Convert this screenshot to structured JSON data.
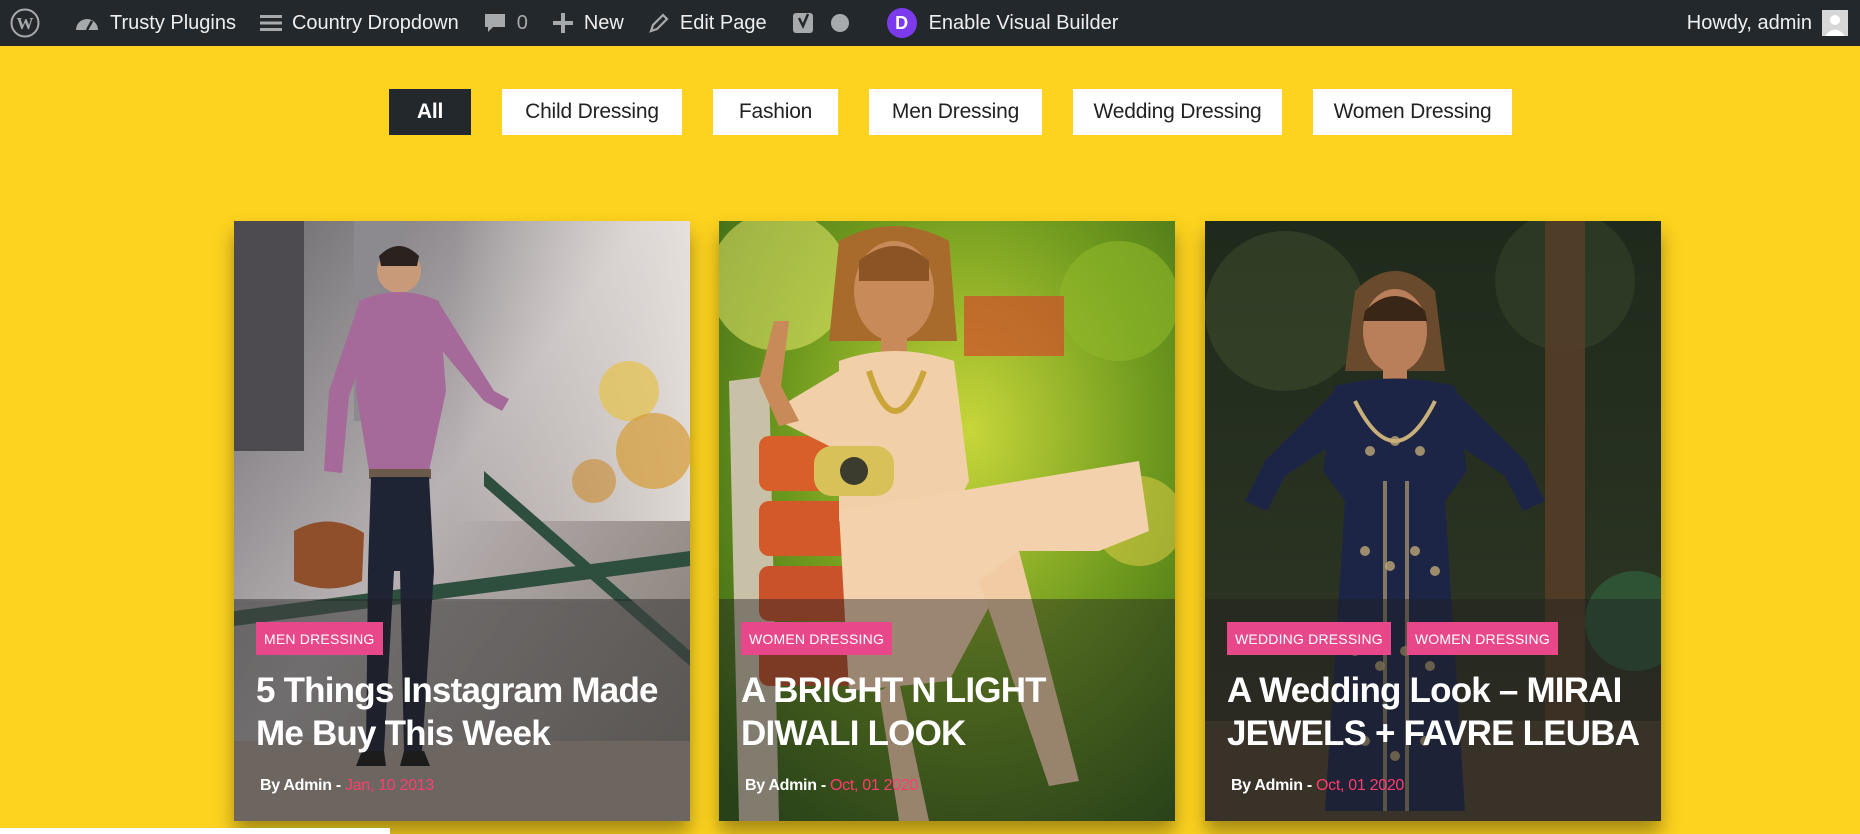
{
  "adminbar": {
    "site_name": "Trusty Plugins",
    "page_name": "Country Dropdown",
    "comments_count": "0",
    "new_label": "New",
    "edit_label": "Edit Page",
    "divi_letter": "D",
    "visual_builder_label": "Enable Visual Builder",
    "howdy_label": "Howdy, admin"
  },
  "filters": [
    {
      "label": "All",
      "active": true
    },
    {
      "label": "Child Dressing"
    },
    {
      "label": "Fashion"
    },
    {
      "label": "Men Dressing"
    },
    {
      "label": "Wedding Dressing"
    },
    {
      "label": "Women Dressing"
    }
  ],
  "posts": [
    {
      "tags": [
        "MEN DRESSING"
      ],
      "title": "5 Things Instagram Made Me Buy This Week",
      "author": "By Admin - ",
      "date": "Jan, 10 2013"
    },
    {
      "tags": [
        "WOMEN DRESSING"
      ],
      "title": "A BRIGHT N LIGHT DIWALI LOOK",
      "author": "By Admin - ",
      "date": "Oct, 01 2020"
    },
    {
      "tags": [
        "WEDDING DRESSING",
        "WOMEN DRESSING"
      ],
      "title": "A Wedding Look – MIRAI JEWELS + FAVRE LEUBA",
      "author": "By Admin - ",
      "date": "Oct, 01 2020"
    }
  ],
  "colors": {
    "page_bg": "#fdd31f",
    "adminbar_bg": "#23282d",
    "tag_bg": "#e8488a",
    "date_color": "#ff3d6e"
  }
}
